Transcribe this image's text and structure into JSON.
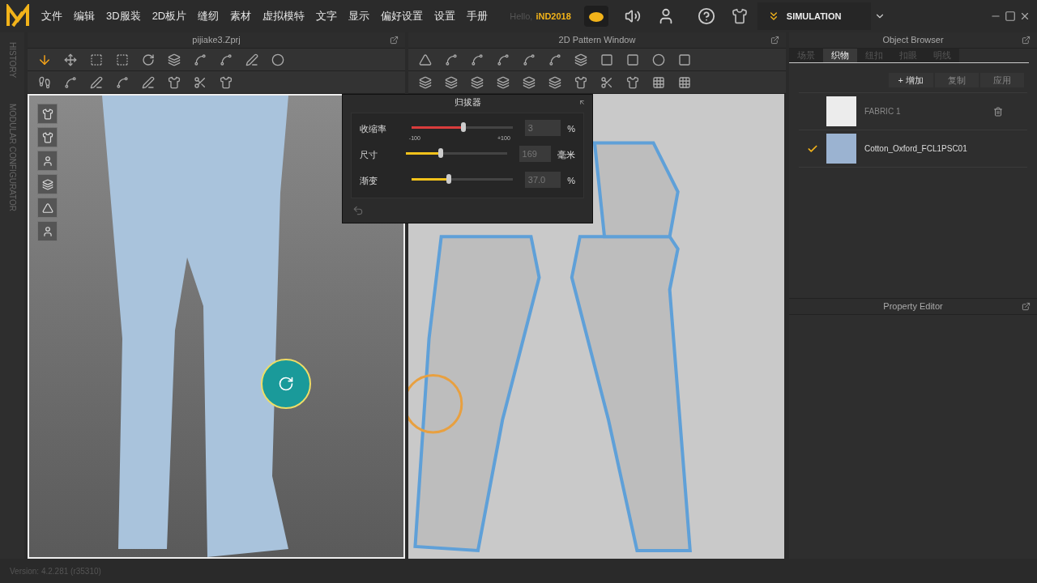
{
  "menu": [
    "文件",
    "编辑",
    "3D服装",
    "2D板片",
    "缝纫",
    "素材",
    "虚拟模特",
    "文字",
    "显示",
    "偏好设置",
    "设置",
    "手册"
  ],
  "user": {
    "greeting": "Hello,",
    "name": "iND2018"
  },
  "mode": {
    "label": "SIMULATION"
  },
  "side_labels": [
    "HISTORY",
    "MODULAR CONFIGURATOR"
  ],
  "window_3d": {
    "title": "pijiake3.Zprj"
  },
  "window_2d": {
    "title": "2D Pattern Window"
  },
  "dialog": {
    "title": "归拔器",
    "sliders": [
      {
        "label": "收缩率",
        "kind": "signed",
        "level": 0.515,
        "value": "3",
        "unit": "%",
        "min_label": "-100",
        "max_label": "+100"
      },
      {
        "label": "尺寸",
        "kind": "plain",
        "level": 0.35,
        "value": "169",
        "unit": "毫米"
      },
      {
        "label": "渐变",
        "kind": "plain",
        "level": 0.37,
        "value": "37.0",
        "unit": "%"
      }
    ]
  },
  "object_browser": {
    "title": "Object Browser",
    "tabs": [
      {
        "label": "场景",
        "selected": false
      },
      {
        "label": "织物",
        "selected": true
      },
      {
        "label": "纽扣",
        "selected": false
      },
      {
        "label": "扣眼",
        "selected": false
      },
      {
        "label": "明线",
        "selected": false
      }
    ],
    "buttons": [
      {
        "label": "+ 增加",
        "disabled": false
      },
      {
        "label": "复制",
        "disabled": true
      },
      {
        "label": "应用",
        "disabled": true
      }
    ],
    "fabrics": [
      {
        "name": "FABRIC 1",
        "color": "#ececec",
        "checked": false
      },
      {
        "name": "Cotton_Oxford_FCL1PSC01",
        "color": "#9bb3d1",
        "checked": true
      }
    ]
  },
  "property_editor": {
    "title": "Property Editor"
  },
  "status_bar": {
    "version": "Version: 4.2.281 (r35310)"
  }
}
